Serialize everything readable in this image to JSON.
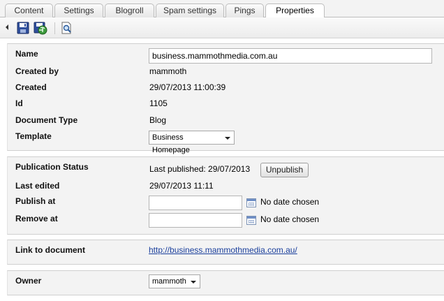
{
  "tabs": [
    {
      "label": "Content",
      "active": false
    },
    {
      "label": "Settings",
      "active": false
    },
    {
      "label": "Blogroll",
      "active": false
    },
    {
      "label": "Spam settings",
      "active": false
    },
    {
      "label": "Pings",
      "active": false
    },
    {
      "label": "Properties",
      "active": true
    }
  ],
  "toolbar": {
    "icons": [
      "collapse-arrow-icon",
      "save-icon",
      "save-and-publish-icon",
      "preview-icon"
    ]
  },
  "properties": {
    "name_label": "Name",
    "name_value": "business.mammothmedia.com.au",
    "created_by_label": "Created by",
    "created_by_value": "mammoth",
    "created_label": "Created",
    "created_value": "29/07/2013 11:00:39",
    "id_label": "Id",
    "id_value": "1105",
    "doctype_label": "Document Type",
    "doctype_value": "Blog",
    "template_label": "Template",
    "template_value": "Business Homepage"
  },
  "publication": {
    "status_label": "Publication Status",
    "status_value": "Last published: 29/07/2013",
    "unpublish_label": "Unpublish",
    "last_edited_label": "Last edited",
    "last_edited_value": "29/07/2013 11:11",
    "publish_at_label": "Publish at",
    "publish_at_value": "",
    "publish_at_note": "No date chosen",
    "remove_at_label": "Remove at",
    "remove_at_value": "",
    "remove_at_note": "No date chosen"
  },
  "link": {
    "label": "Link to document",
    "url": "http://business.mammothmedia.com.au/"
  },
  "owner": {
    "label": "Owner",
    "value": "mammoth"
  },
  "colors": {
    "panel_bg": "#f3f3f3",
    "link": "#1a3f9c",
    "border": "#bdbdbd"
  }
}
